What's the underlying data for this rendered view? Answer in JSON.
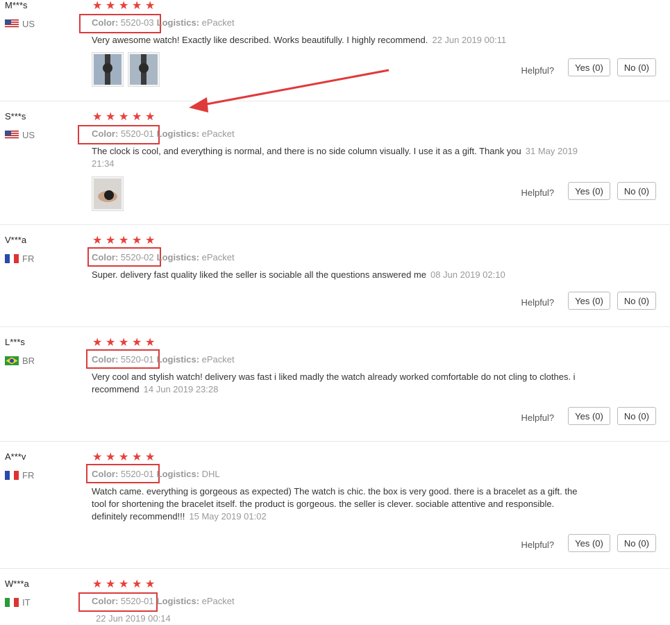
{
  "labels": {
    "color_key": "Color:",
    "logistics_key": "Logistics:",
    "helpful": "Helpful?",
    "yes": "Yes (0)",
    "no": "No (0)"
  },
  "reviews": [
    {
      "user": "M***s",
      "country": "US",
      "color": "5520-03",
      "logistics": "ePacket",
      "text": "Very awesome watch! Exactly like described. Works beautifully. I highly recommend.",
      "date": "22 Jun 2019 00:11",
      "photos": 2
    },
    {
      "user": "S***s",
      "country": "US",
      "color": "5520-01",
      "logistics": "ePacket",
      "text": "The clock is cool, and everything is normal, and there is no side column visually. I use it as a gift. Thank you",
      "date": "31 May 2019 21:34",
      "photos": 1
    },
    {
      "user": "V***a",
      "country": "FR",
      "color": "5520-02",
      "logistics": "ePacket",
      "text": "Super. delivery fast quality liked the seller is sociable all the questions answered me",
      "date": "08 Jun 2019 02:10",
      "photos": 0
    },
    {
      "user": "L***s",
      "country": "BR",
      "color": "5520-01",
      "logistics": "ePacket",
      "text": "Very cool and stylish watch! delivery was fast i liked madly the watch already worked comfortable do not cling to clothes. i recommend",
      "date": "14 Jun 2019 23:28",
      "photos": 0
    },
    {
      "user": "A***v",
      "country": "FR",
      "color": "5520-01",
      "logistics": "DHL",
      "text": "Watch came. everything is gorgeous as expected) The watch is chic. the box is very good. there is a bracelet as a gift. the tool for shortening the bracelet itself. the product is gorgeous. the seller is clever. sociable attentive and responsible. definitely recommend!!!",
      "date": "15 May 2019 01:02",
      "photos": 0
    },
    {
      "user": "W***a",
      "country": "IT",
      "color": "5520-01",
      "logistics": "ePacket",
      "text": "",
      "date": "22 Jun 2019 00:14",
      "photos": 0
    }
  ],
  "colors": {
    "star": "#e8403b",
    "highlight": "#d93b3b",
    "arrow": "#e03a3a"
  }
}
